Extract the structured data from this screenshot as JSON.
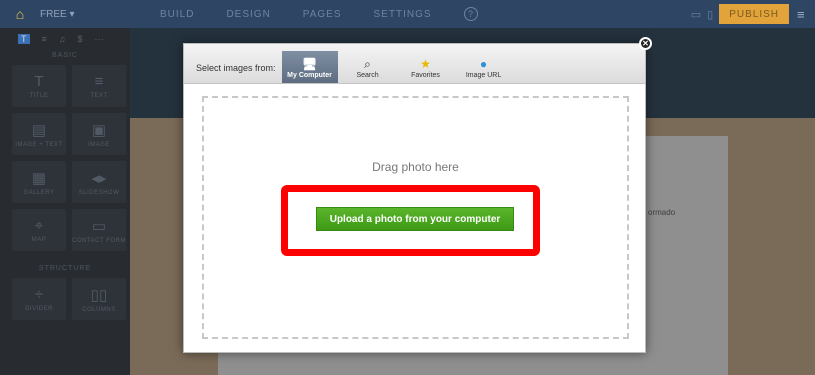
{
  "topbar": {
    "plan": "FREE ▾",
    "nav": [
      "BUILD",
      "DESIGN",
      "PAGES",
      "SETTINGS"
    ],
    "help": "?",
    "publish": "PUBLISH"
  },
  "sidebar": {
    "tabs": [
      "T",
      "≡",
      "♫",
      "$",
      "···"
    ],
    "section_basic": "BASIC",
    "basic_items": [
      {
        "icon": "T",
        "label": "TITLE"
      },
      {
        "icon": "≡",
        "label": "TEXT"
      },
      {
        "icon": "▤",
        "label": "IMAGE + TEXT"
      },
      {
        "icon": "▣",
        "label": "IMAGE"
      },
      {
        "icon": "▦",
        "label": "GALLERY"
      },
      {
        "icon": "◂▸",
        "label": "SLIDESHOW"
      },
      {
        "icon": "⌖",
        "label": "MAP"
      },
      {
        "icon": "▭",
        "label": "CONTACT FORM"
      }
    ],
    "section_structure": "STRUCTURE",
    "structure_items": [
      {
        "icon": "÷",
        "label": "DIVIDER"
      },
      {
        "icon": "▯▯",
        "label": "COLUMNS"
      }
    ]
  },
  "dialog": {
    "select_label": "Select images from:",
    "tabs": [
      {
        "label": "My Computer",
        "icon": "🖥"
      },
      {
        "label": "Search",
        "icon": "⌕"
      },
      {
        "label": "Favorites",
        "icon": "★"
      },
      {
        "label": "Image URL",
        "icon": "●"
      }
    ],
    "drag_text": "Drag photo here",
    "upload_button": "Upload a photo from your computer"
  },
  "background_text": "ormado",
  "colors": {
    "accent_red": "#ff0000",
    "upload_green": "#4aa81f",
    "topbar": "#2f4564",
    "publish": "#e2a33a"
  }
}
